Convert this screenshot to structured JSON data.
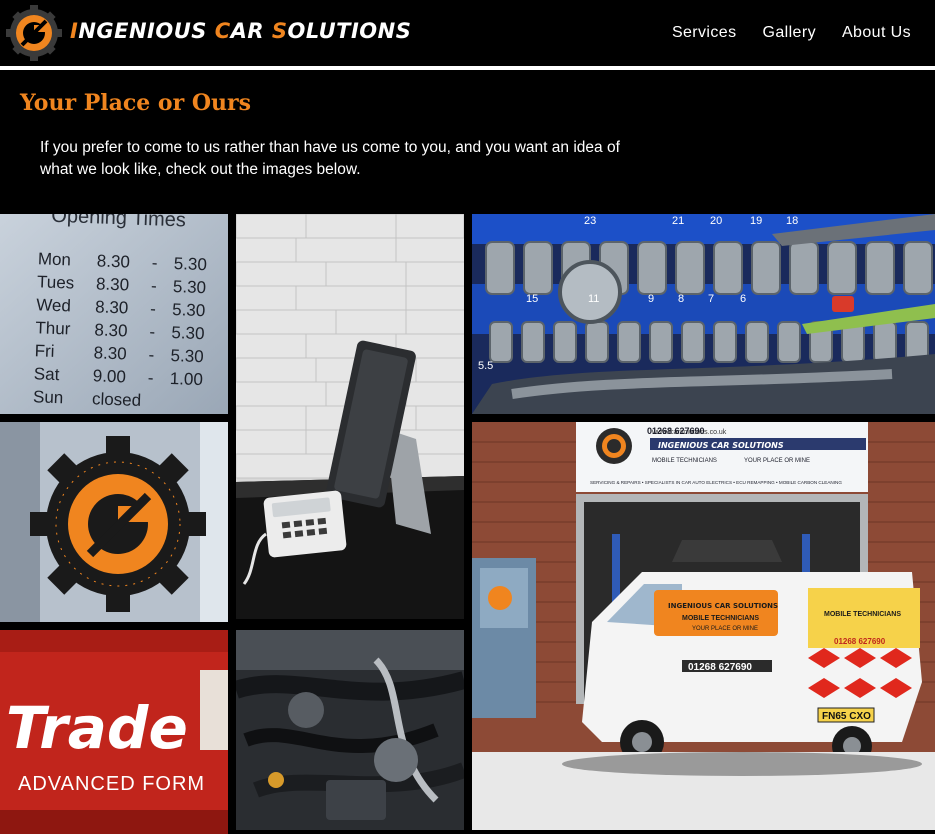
{
  "header": {
    "brand": {
      "w1_first": "I",
      "w1_rest": "NGENIOUS ",
      "w2_first": "C",
      "w2_rest": "AR ",
      "w3_first": "S",
      "w3_rest": "OLUTIONS"
    },
    "nav": [
      "Services",
      "Gallery",
      "About Us"
    ]
  },
  "page": {
    "title": "Your Place or Ours",
    "intro": "If you prefer to come to us rather than have us come to you, and you want an idea of what we look like, check out the images below."
  },
  "gallery": {
    "opening_times": {
      "heading": "Opening Times",
      "rows": [
        {
          "day": "Mon",
          "open": "8.30",
          "sep": "-",
          "close": "5.30"
        },
        {
          "day": "Tues",
          "open": "8.30",
          "sep": "-",
          "close": "5.30"
        },
        {
          "day": "Wed",
          "open": "8.30",
          "sep": "-",
          "close": "5.30"
        },
        {
          "day": "Thur",
          "open": "8.30",
          "sep": "-",
          "close": "5.30"
        },
        {
          "day": "Fri",
          "open": "8.30",
          "sep": "-",
          "close": "5.30"
        },
        {
          "day": "Sat",
          "open": "9.00",
          "sep": "-",
          "close": "1.00"
        },
        {
          "day": "Sun",
          "open": "closed",
          "sep": "",
          "close": ""
        }
      ]
    },
    "sockets": {
      "sizes": [
        "23",
        "21",
        "20",
        "19",
        "18",
        "15",
        "11",
        "9",
        "8",
        "7",
        "6",
        "5.5"
      ]
    },
    "oil": {
      "brand": "Trade",
      "sub": "ADVANCED FORM"
    },
    "workshop": {
      "url": "www.icarsolutions.co.uk",
      "phone": "01268 627690",
      "name": "INGENIOUS CAR SOLUTIONS",
      "tagline_left": "MOBILE TECHNICIANS",
      "tagline_right": "YOUR PLACE OR MINE",
      "services": "SERVICING & REPAIRS  •  SPECIALISTS IN CAR AUTO ELECTRICS  •  ECU REMAPPING  •  MOBILE CARBON CLEANING",
      "van_line1": "INGENIOUS CAR SOLUTIONS",
      "van_line2": "MOBILE TECHNICIANS",
      "van_line3": "YOUR PLACE OR MINE",
      "van_phone": "01268 627690",
      "van_rear_title": "MOBILE TECHNICIANS",
      "van_rear_phone": "01268 627690",
      "plate": "FN65 CXO"
    }
  },
  "colors": {
    "accent": "#f0851f",
    "background": "#000000",
    "text": "#ffffff"
  }
}
